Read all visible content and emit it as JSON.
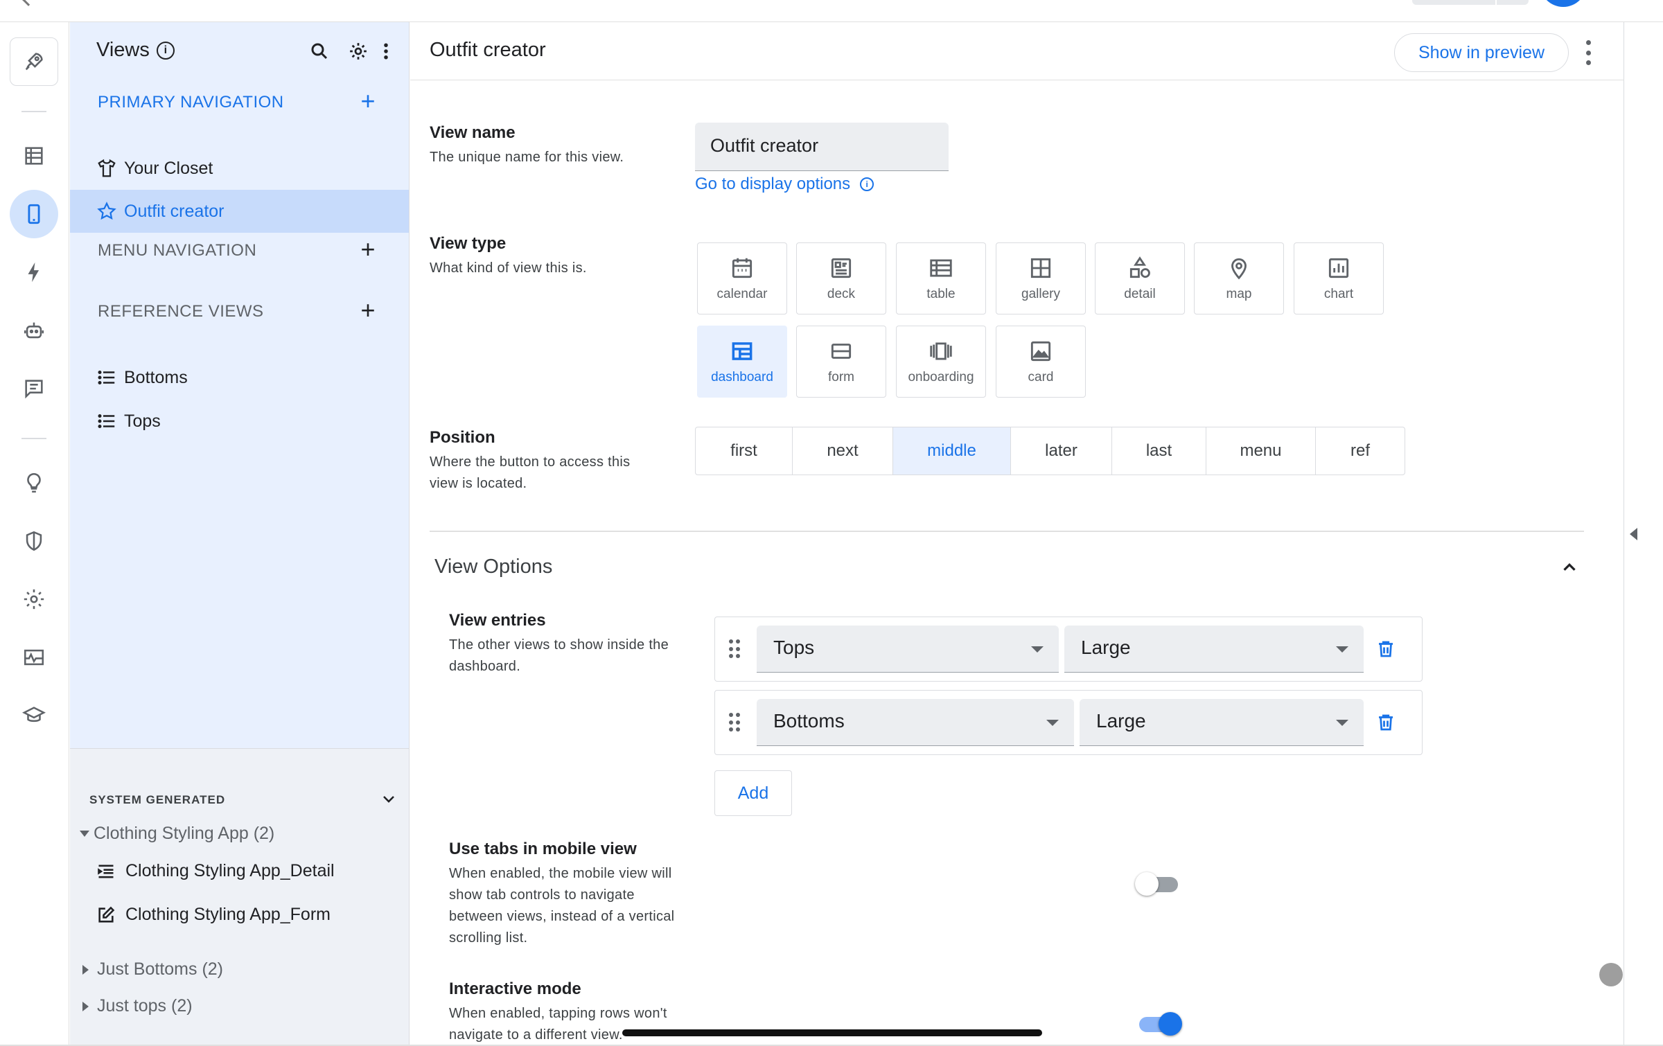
{
  "views_panel": {
    "title": "Views",
    "primary_navigation": {
      "title": "PRIMARY NAVIGATION",
      "items": [
        {
          "label": "Your Closet",
          "icon": "shirt-icon"
        },
        {
          "label": "Outfit creator",
          "icon": "star-icon",
          "active": true
        }
      ]
    },
    "menu_navigation": {
      "title": "MENU NAVIGATION"
    },
    "reference_views": {
      "title": "REFERENCE VIEWS",
      "items": [
        {
          "label": "Bottoms",
          "icon": "list-icon"
        },
        {
          "label": "Tops",
          "icon": "list-icon"
        }
      ]
    },
    "system_generated": {
      "title": "SYSTEM GENERATED",
      "groups": [
        {
          "label": "Clothing Styling App (2)",
          "expanded": true,
          "items": [
            {
              "label": "Clothing Styling App_Detail",
              "icon": "detail-list-icon"
            },
            {
              "label": "Clothing Styling App_Form",
              "icon": "edit-icon"
            }
          ]
        },
        {
          "label": "Just Bottoms (2)",
          "expanded": false
        },
        {
          "label": "Just tops (2)",
          "expanded": false
        }
      ]
    }
  },
  "editor": {
    "title": "Outfit creator",
    "show_in_preview": "Show in preview",
    "view_name": {
      "label": "View name",
      "description": "The unique name for this view.",
      "value": "Outfit creator",
      "link": "Go to display options"
    },
    "view_type": {
      "label": "View type",
      "description": "What kind of view this is.",
      "options": [
        "calendar",
        "deck",
        "table",
        "gallery",
        "detail",
        "map",
        "chart",
        "dashboard",
        "form",
        "onboarding",
        "card"
      ],
      "selected": "dashboard"
    },
    "position": {
      "label": "Position",
      "description_line1": "Where the button to access this",
      "description_line2": "view is located.",
      "options": [
        "first",
        "next",
        "middle",
        "later",
        "last",
        "menu",
        "ref"
      ],
      "selected": "middle"
    },
    "view_options": {
      "title": "View Options",
      "view_entries": {
        "label": "View entries",
        "description_line1": "The other views to show inside the",
        "description_line2": "dashboard.",
        "entries": [
          {
            "view": "Tops",
            "size": "Large"
          },
          {
            "view": "Bottoms",
            "size": "Large"
          }
        ],
        "add_label": "Add"
      },
      "use_tabs": {
        "label": "Use tabs in mobile view",
        "description_lines": [
          "When enabled, the mobile view will",
          "show tab controls to navigate",
          "between views, instead of a vertical",
          "scrolling list."
        ],
        "enabled": false
      },
      "interactive_mode": {
        "label": "Interactive mode",
        "description_lines": [
          "When enabled, tapping rows won't",
          "navigate to a different view."
        ],
        "enabled": true
      }
    }
  },
  "colors": {
    "accent": "#1a73e8",
    "panel_bg": "#e8f0fe",
    "active_bg": "#c7dbfb"
  }
}
